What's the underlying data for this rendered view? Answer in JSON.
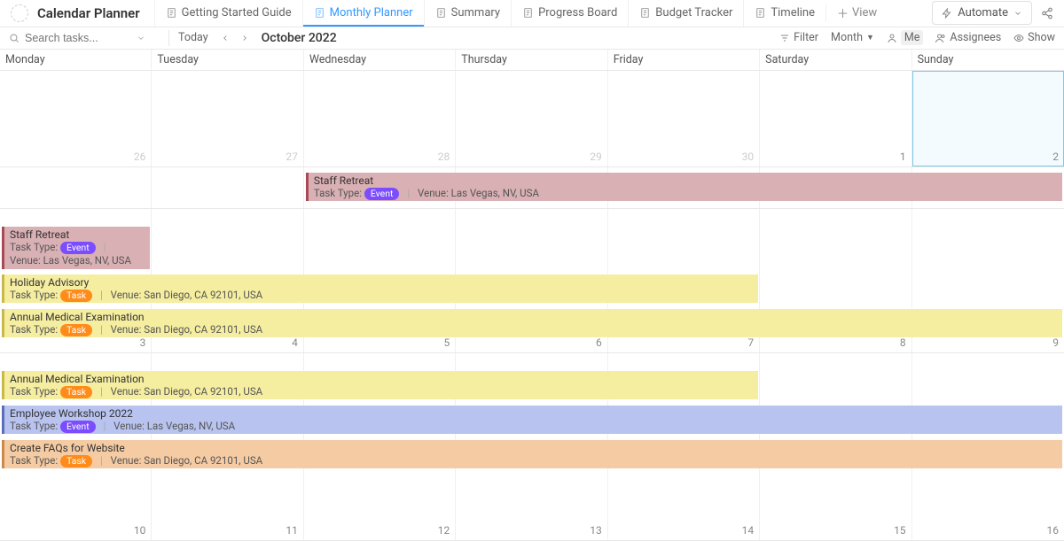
{
  "header": {
    "title": "Calendar Planner",
    "tabs": [
      {
        "label": "Getting Started Guide",
        "active": false
      },
      {
        "label": "Monthly Planner",
        "active": true
      },
      {
        "label": "Summary",
        "active": false
      },
      {
        "label": "Progress Board",
        "active": false
      },
      {
        "label": "Budget Tracker",
        "active": false
      },
      {
        "label": "Timeline",
        "active": false
      }
    ],
    "add_view": "View",
    "automate": "Automate"
  },
  "toolbar": {
    "search_placeholder": "Search tasks...",
    "today": "Today",
    "month_label": "October 2022",
    "filter": "Filter",
    "period": "Month",
    "me": "Me",
    "assignees": "Assignees",
    "show": "Show"
  },
  "days": [
    "Monday",
    "Tuesday",
    "Wednesday",
    "Thursday",
    "Friday",
    "Saturday",
    "Sunday"
  ],
  "weeks": [
    {
      "nums": [
        "26",
        "27",
        "28",
        "29",
        "30",
        "1",
        "2"
      ],
      "other": [
        true,
        true,
        true,
        true,
        true,
        false,
        false
      ],
      "today": 6
    },
    {
      "nums": [
        "",
        "",
        "",
        "",
        "",
        "",
        ""
      ],
      "other": [
        false,
        false,
        false,
        false,
        false,
        false,
        false
      ],
      "today": -1
    },
    {
      "nums": [
        "3",
        "4",
        "5",
        "6",
        "7",
        "8",
        "9"
      ],
      "other": [
        false,
        false,
        false,
        false,
        false,
        false,
        false
      ],
      "today": -1
    },
    {
      "nums": [
        "10",
        "11",
        "12",
        "13",
        "14",
        "15",
        "16"
      ],
      "other": [
        false,
        false,
        false,
        false,
        false,
        false,
        false
      ],
      "today": -1
    }
  ],
  "labels": {
    "task_type": "Task Type:",
    "venue": "Venue:",
    "badge_event": "Event",
    "badge_task": "Task"
  },
  "events": {
    "staff_retreat": {
      "title": "Staff Retreat",
      "venue": "Las Vegas, NV, USA"
    },
    "holiday_advisory": {
      "title": "Holiday Advisory",
      "venue": "San Diego, CA 92101, USA"
    },
    "annual_medical": {
      "title": "Annual Medical Examination",
      "venue": "San Diego, CA 92101, USA"
    },
    "employee_workshop": {
      "title": "Employee Workshop 2022",
      "venue": "Las Vegas, NV, USA"
    },
    "create_faqs": {
      "title": "Create FAQs for Website",
      "venue": "San Diego, CA 92101, USA"
    }
  }
}
